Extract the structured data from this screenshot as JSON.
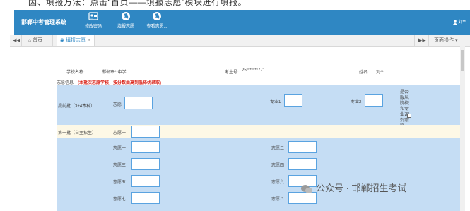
{
  "caption": "因、填报方法：点击“首页——填报志愿”模块进行填报。",
  "header": {
    "system_title": "邯郸中考管理系统",
    "nav": [
      {
        "label": "修改密码",
        "icon": "id-card-icon"
      },
      {
        "label": "填报志愿",
        "icon": "globe-icon"
      },
      {
        "label": "查看志愿...",
        "icon": "globe-icon"
      }
    ],
    "user_name": "刘**"
  },
  "tabs": {
    "home_label": "首页",
    "active_label": "填报志愿",
    "page_ops_label": "页面操作"
  },
  "info": {
    "school_label": "学校名称:",
    "school_value": "邯郸市**中学",
    "exam_label": "考生号:",
    "exam_value": "25*******771",
    "name_label": "姓名:",
    "name_value": "刘**"
  },
  "notice": {
    "prefix": "志愿信息",
    "text": "(本批次志愿学校，按分数由高到低择优录取)"
  },
  "batch_early": {
    "label": "提前批（3+4本科）",
    "field_label": "志愿",
    "major1_label": "专业1",
    "major2_label": "专业2",
    "adjust_label": "是否服从院校和专业调剂志愿"
  },
  "batch_first": {
    "label": "第一批（自主招生）",
    "field_label": "志愿一"
  },
  "choices": [
    "志愿一",
    "志愿二",
    "志愿三",
    "志愿四",
    "志愿五",
    "志愿六",
    "志愿七",
    "志愿八"
  ],
  "watermark": "公众号 · 邯郸招生考试",
  "colors": {
    "header": "#2f87c3",
    "light_blue": "#c5ddf4",
    "light_yellow": "#fdf8e6",
    "notice_red": "#d9261c"
  }
}
